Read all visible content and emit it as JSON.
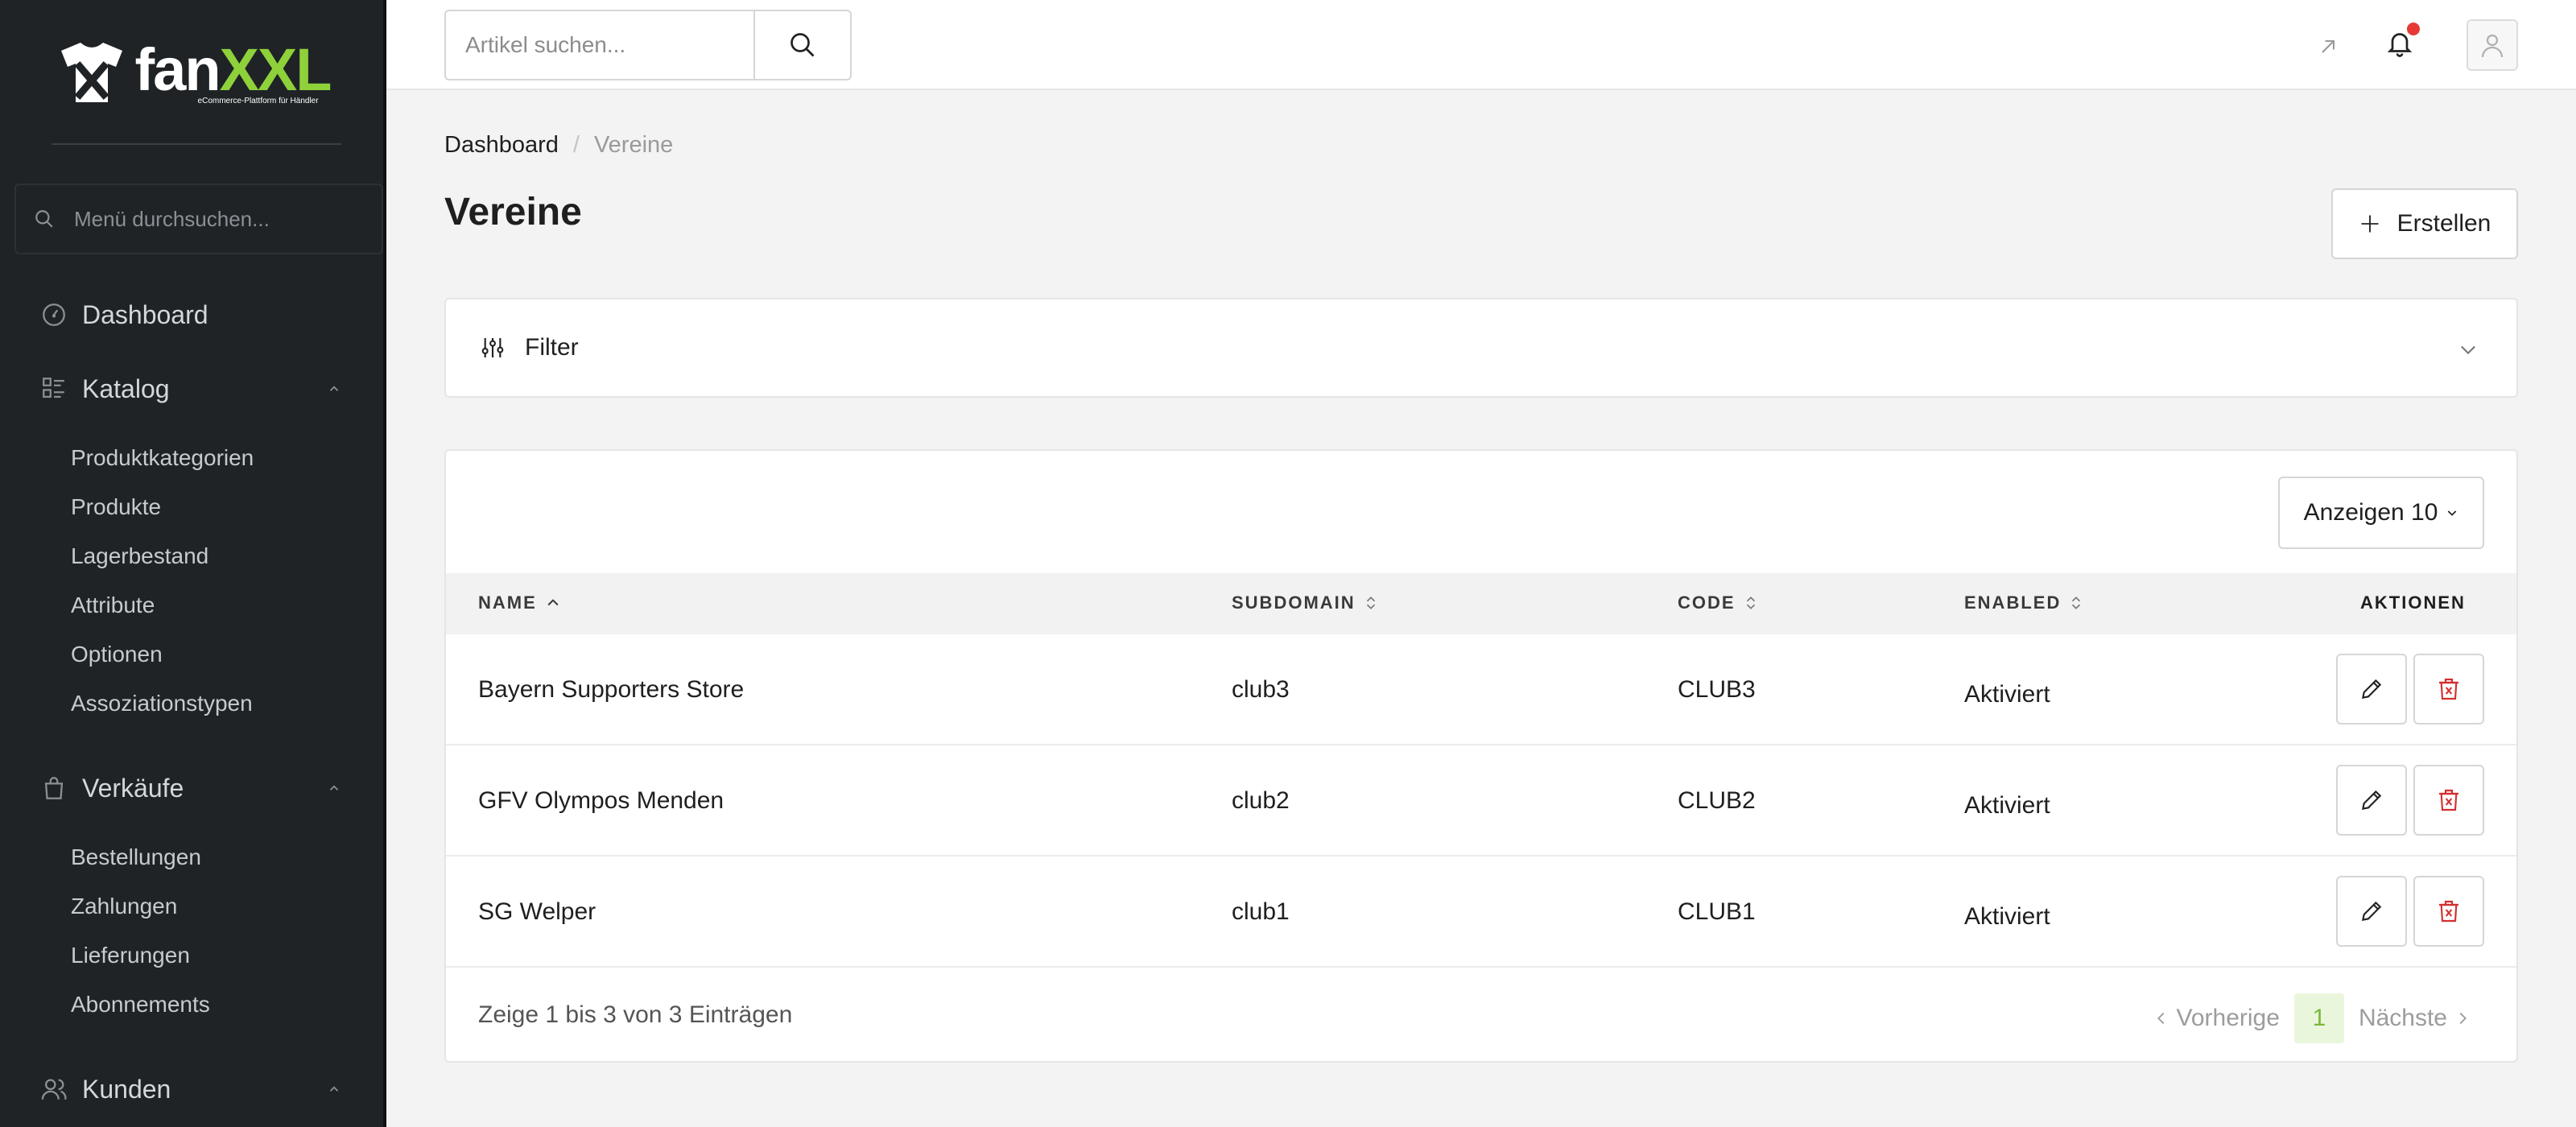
{
  "brand": {
    "name_part1": "fan",
    "name_part2": "XXL",
    "tagline": "eCommerce-Plattform für Händler",
    "accent_color": "#8ed13a"
  },
  "sidebar": {
    "search_placeholder": "Menü durchsuchen...",
    "sections": [
      {
        "label": "Dashboard",
        "icon": "dashboard-icon"
      },
      {
        "label": "Katalog",
        "icon": "catalog-icon",
        "expanded": true,
        "items": [
          "Produktkategorien",
          "Produkte",
          "Lagerbestand",
          "Attribute",
          "Optionen",
          "Assoziationstypen"
        ]
      },
      {
        "label": "Verkäufe",
        "icon": "shopping-bag-icon",
        "expanded": true,
        "items": [
          "Bestellungen",
          "Zahlungen",
          "Lieferungen",
          "Abonnements"
        ]
      },
      {
        "label": "Kunden",
        "icon": "users-icon",
        "expanded": true
      }
    ]
  },
  "topbar": {
    "search_placeholder": "Artikel suchen...",
    "notification_dot_color": "#e53935"
  },
  "breadcrumb": {
    "home": "Dashboard",
    "separator": "/",
    "current": "Vereine"
  },
  "page": {
    "title": "Vereine",
    "create_label": "Erstellen"
  },
  "filter": {
    "label": "Filter"
  },
  "table": {
    "page_size_label": "Anzeigen 10",
    "columns": {
      "name": "NAME",
      "subdomain": "SUBDOMAIN",
      "code": "CODE",
      "enabled": "ENABLED",
      "actions": "AKTIONEN"
    },
    "rows": [
      {
        "name": "Bayern Supporters Store",
        "subdomain": "club3",
        "code": "CLUB3",
        "enabled": "Aktiviert"
      },
      {
        "name": "GFV Olympos Menden",
        "subdomain": "club2",
        "code": "CLUB2",
        "enabled": "Aktiviert"
      },
      {
        "name": "SG Welper",
        "subdomain": "club1",
        "code": "CLUB1",
        "enabled": "Aktiviert"
      }
    ],
    "footer_info": "Zeige 1 bis 3 von 3 Einträgen",
    "pagination": {
      "prev": "Vorherige",
      "current": "1",
      "next": "Nächste"
    },
    "delete_color": "#d32f2f"
  }
}
